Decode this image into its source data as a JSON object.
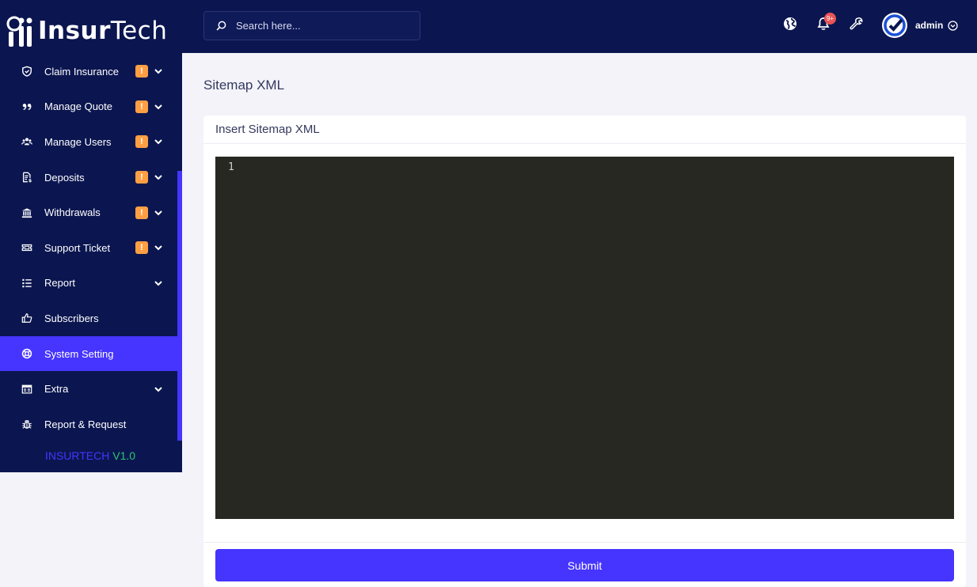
{
  "brand": {
    "logo_bold": "Insur",
    "logo_light": "Tech",
    "version_name": "INSURTECH",
    "version_number": "V1.0"
  },
  "search": {
    "placeholder": "Search here..."
  },
  "topbar": {
    "notification_badge": "9+",
    "user_name": "admin"
  },
  "sidebar": {
    "items": [
      {
        "label": "Claim Insurance",
        "icon": "shield-icon",
        "badge": "!",
        "has_submenu": true
      },
      {
        "label": "Manage Quote",
        "icon": "quote-icon",
        "badge": "!",
        "has_submenu": true
      },
      {
        "label": "Manage Users",
        "icon": "users-icon",
        "badge": "!",
        "has_submenu": true
      },
      {
        "label": "Deposits",
        "icon": "invoice-icon",
        "badge": "!",
        "has_submenu": true
      },
      {
        "label": "Withdrawals",
        "icon": "bank-icon",
        "badge": "!",
        "has_submenu": true
      },
      {
        "label": "Support Ticket",
        "icon": "ticket-icon",
        "badge": "!",
        "has_submenu": true
      },
      {
        "label": "Report",
        "icon": "list-icon",
        "badge": "",
        "has_submenu": true
      },
      {
        "label": "Subscribers",
        "icon": "thumbs-up-icon",
        "badge": "",
        "has_submenu": false
      },
      {
        "label": "System Setting",
        "icon": "life-ring-icon",
        "badge": "",
        "has_submenu": false,
        "active": true
      },
      {
        "label": "Extra",
        "icon": "server-icon",
        "badge": "",
        "has_submenu": true
      },
      {
        "label": "Report & Request",
        "icon": "bug-icon",
        "badge": "",
        "has_submenu": false
      }
    ]
  },
  "main": {
    "page_title": "Sitemap XML",
    "card_title": "Insert Sitemap XML",
    "editor": {
      "line_number": "1"
    },
    "submit_label": "Submit"
  },
  "colors": {
    "sidebar_bg": "#0b1650",
    "accent": "#4634ff",
    "badge": "#ff9f43",
    "editor_bg": "#272822",
    "version_number": "#28c76f"
  }
}
